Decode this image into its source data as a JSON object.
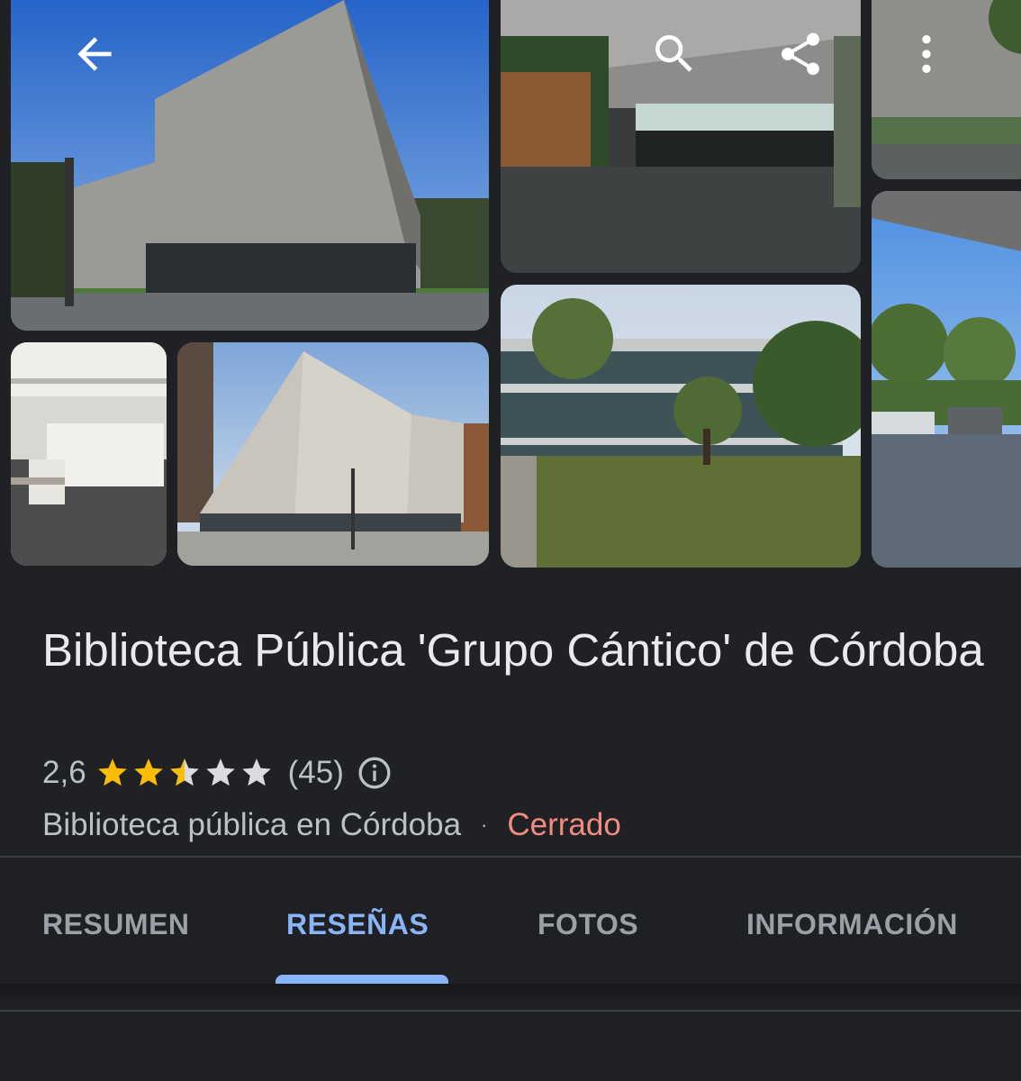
{
  "header": {
    "icons": [
      "back-arrow-icon",
      "search-icon",
      "share-icon",
      "more-vert-icon"
    ]
  },
  "place": {
    "name": "Biblioteca Pública 'Grupo Cántico' de Córdoba",
    "rating": "2,6",
    "rating_value": 2.6,
    "stars_max": 5,
    "review_count": "(45)",
    "category": "Biblioteca pública en Córdoba",
    "separator": "·",
    "status": "Cerrado"
  },
  "tabs": [
    {
      "label": "RESUMEN",
      "active": false
    },
    {
      "label": "RESEÑAS",
      "active": true
    },
    {
      "label": "FOTOS",
      "active": false
    },
    {
      "label": "INFORMACIÓN",
      "active": false
    }
  ],
  "colors": {
    "background": "#202124",
    "text": "#e8eaed",
    "secondary_text": "#bdc1c6",
    "star": "#fbbc04",
    "star_empty": "#dadce0",
    "closed": "#f28b82",
    "active_tab": "#8ab4f8"
  }
}
